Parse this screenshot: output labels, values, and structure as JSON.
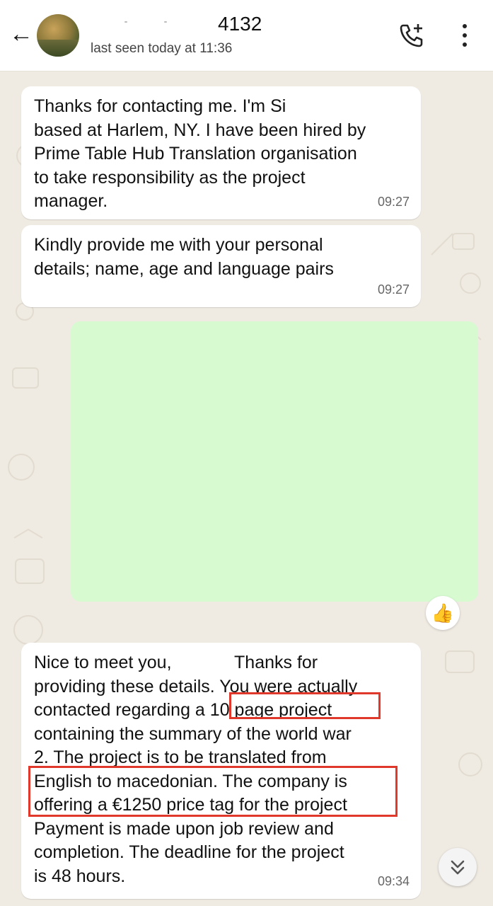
{
  "header": {
    "contact_name": "4132",
    "last_seen": "last seen today at 11:36"
  },
  "icons": {
    "back": "arrow-left-icon",
    "call": "add-call-icon",
    "menu": "more-vert-icon",
    "scroll": "double-chevron-down-icon"
  },
  "messages": [
    {
      "lines": [
        "Thanks for contacting me. I'm Si",
        "based at Harlem, NY.  I have been hired by",
        "Prime Table Hub Translation organisation",
        "to take responsibility as the project",
        "manager."
      ],
      "time": "09:27"
    },
    {
      "lines": [
        "Kindly provide me with your personal",
        "details; name, age and language pairs"
      ],
      "time": "09:27"
    },
    {
      "lines": [
        "Nice to meet you,",
        "Thanks for",
        "providing these details. You were actually",
        "contacted regarding a",
        "10 page project",
        "containing the summary of the world war",
        "2. The project is to be translated from",
        "English to macedonian. The company is",
        "offering a €1250 price tag for the project",
        "Payment is made upon job review and",
        "completion. The deadline for the project",
        "is 48 hours."
      ],
      "time": "09:34"
    }
  ],
  "reaction": "👍",
  "colors": {
    "chat_background": "#efeae2",
    "media_placeholder": "#d7fad1",
    "highlight_box": "#e0382a"
  }
}
